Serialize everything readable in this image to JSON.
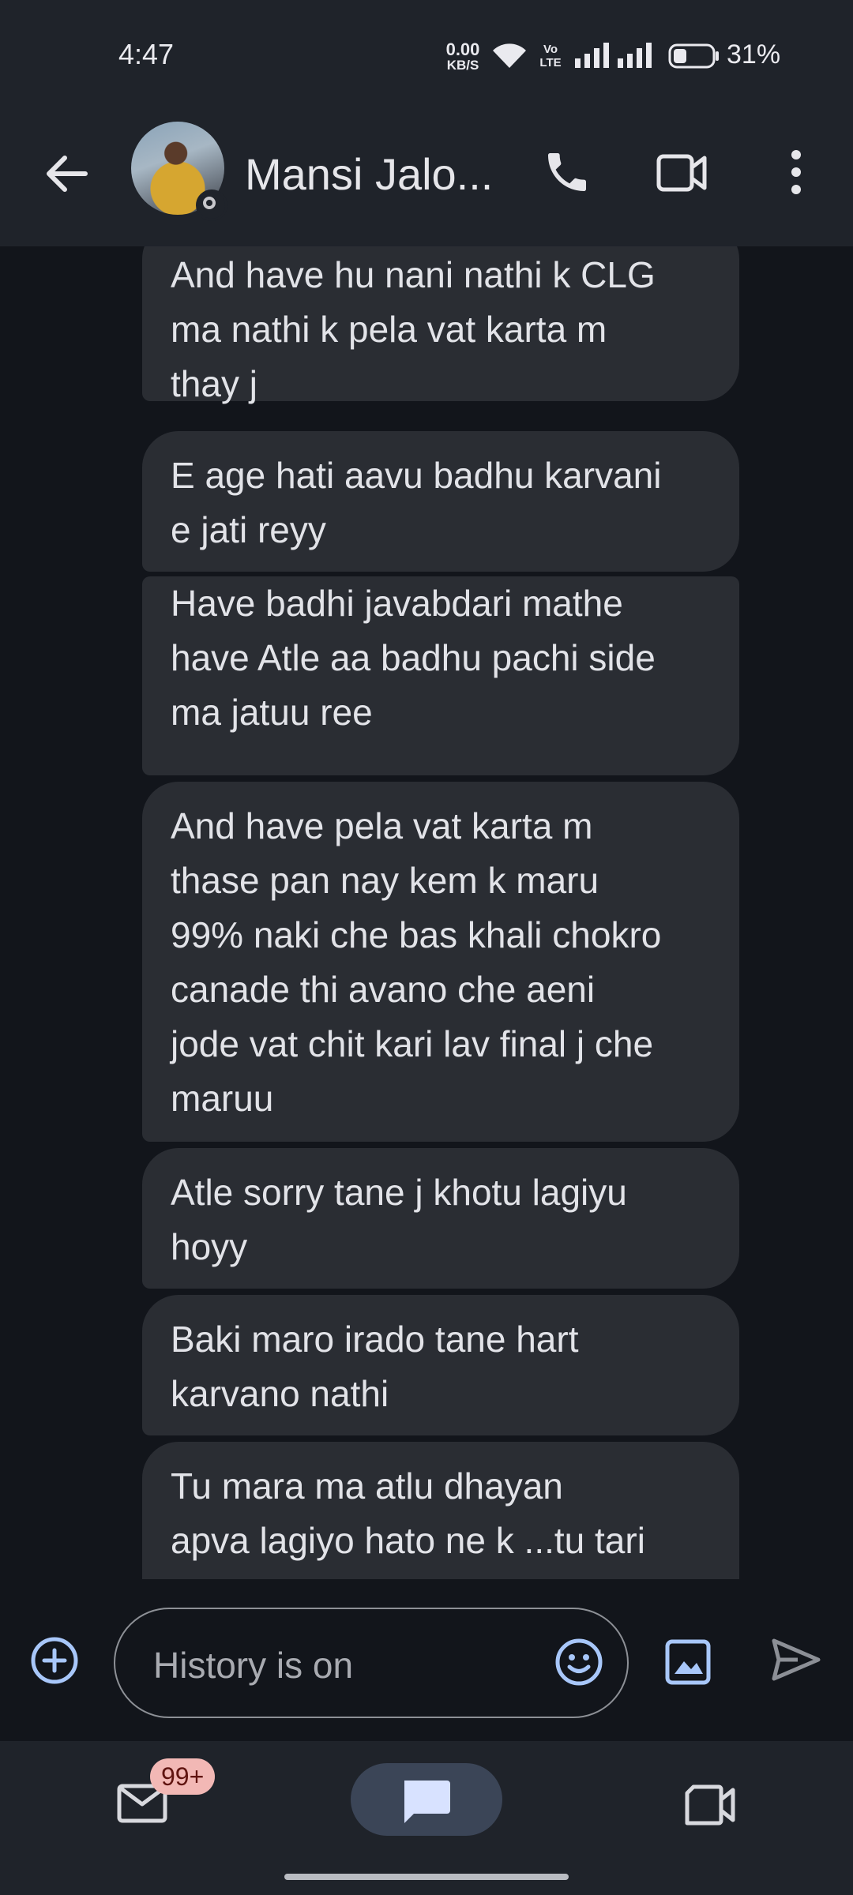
{
  "status_bar": {
    "time": "4:47",
    "net_speed_value": "0.00",
    "net_speed_unit": "KB/S",
    "network_label": "Vo LTE",
    "battery_percent": "31%"
  },
  "header": {
    "contact_name": "Mansi Jalo..."
  },
  "messages": [
    {
      "text": "And have hu nani nathi k CLG\nma nathi k pela vat karta m\nthay j"
    },
    {
      "text": "E age hati aavu badhu karvani\ne jati reyy"
    },
    {
      "text": "Have badhi javabdari mathe\nhave Atle aa badhu pachi side\nma jatuu ree"
    },
    {
      "text": "And have pela vat karta m\nthase pan nay kem k maru\n99% naki che bas khali chokro\ncanade thi avano che aeni\njode vat chit kari lav final j che\nmaruu"
    },
    {
      "text": "Atle sorry tane j khotu lagiyu\nhoyy"
    },
    {
      "text": "Baki maro irado tane hart\nkarvano nathi"
    },
    {
      "text": "Tu mara ma atlu dhayan\napva lagiyo hato ne k ...tu tari"
    }
  ],
  "composer": {
    "placeholder": "History is on"
  },
  "bottom_nav": {
    "mail_badge": "99+"
  },
  "colors": {
    "background": "#12151b",
    "bar": "#1f232a",
    "bubble": "#2a2d33",
    "accent": "#a8c7fa",
    "chat_pill": "#3b4557",
    "badge": "#f2b8b5"
  }
}
